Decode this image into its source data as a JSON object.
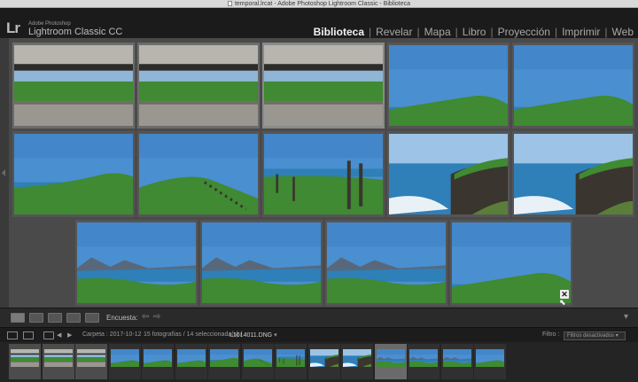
{
  "window": {
    "title": "temporal.lrcat - Adobe Photoshop Lightroom Classic - Biblioteca"
  },
  "identity": {
    "logo": "Lr",
    "small": "Adobe Photoshop",
    "name": "Lightroom Classic CC"
  },
  "modules": {
    "biblioteca": "Biblioteca",
    "revelar": "Revelar",
    "mapa": "Mapa",
    "libro": "Libro",
    "proyeccion": "Proyección",
    "imprimir": "Imprimir",
    "web": "Web",
    "sep": "|"
  },
  "grid": {
    "rows": [
      [
        "fence",
        "fence",
        "fence",
        "meadow",
        "meadow"
      ],
      [
        "coast",
        "hillfence",
        "fenceposts",
        "cliffsea",
        "cliffsea"
      ],
      [
        "mountainbay",
        "mountainbay",
        "mountainbay",
        "meadow"
      ]
    ],
    "selected": [
      0,
      1,
      2
    ],
    "primary": 2
  },
  "toolbar": {
    "survey_label": "Encuesta:",
    "prev": "⇦",
    "next": "⇨",
    "dropdown": "▾"
  },
  "close_glyph": "✕",
  "cursor": "⬉",
  "filmstrip_bar": {
    "prev": "◀",
    "next": "▶",
    "folder_label": "Carpeta : 2017-10-12",
    "count_text": "15 fotografías / 14 seleccionada(s) /",
    "filename": "L1014011.DNG",
    "filename_dropdown": "▾",
    "filter_label": "Filtro :",
    "filter_value": "Filtros desactivados",
    "filter_dropdown": "▾"
  },
  "filmstrip": {
    "thumbs": [
      "fence",
      "fence",
      "fence",
      "meadow",
      "meadow",
      "meadow",
      "coast",
      "hillfence",
      "fenceposts",
      "cliffsea",
      "cliffsea",
      "mountainbay",
      "mountainbay",
      "mountainbay",
      "meadow"
    ],
    "selected": [
      0,
      1,
      2
    ],
    "primary": 11
  },
  "colors": {
    "sky": "#4a8fd0",
    "sky_light": "#9dc3e6",
    "grass": "#3f8a32",
    "sea": "#2f7fb8",
    "rock": "#3a352e",
    "wood": "#9a9690",
    "bg": "#4a4a4a"
  }
}
